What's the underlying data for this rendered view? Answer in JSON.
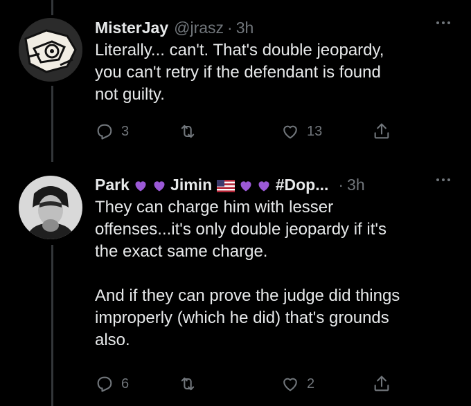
{
  "tweets": [
    {
      "name": "MisterJay",
      "handle": "@jrasz",
      "separator": "·",
      "time": "3h",
      "text": "Literally... can't. That's double jeopardy,\nyou can't retry if the defendant is found\nnot guilty.",
      "replies": "3",
      "retweets": "",
      "likes": "13"
    },
    {
      "name_parts": [
        "Park",
        "💜",
        "💜",
        "Jimin",
        "🇺🇸",
        "💜",
        "💜",
        "#Dop..."
      ],
      "separator": "·",
      "time": "3h",
      "text": "They can charge him with lesser\noffenses...it's only double jeopardy if it's\nthe exact same charge.\n\nAnd if they can prove the judge did things\nimproperly (which he did) that's grounds\nalso.",
      "replies": "6",
      "retweets": "",
      "likes": "2"
    }
  ],
  "colors": {
    "background": "#000000",
    "text": "#e7e9ea",
    "secondary": "#71767b",
    "thread_line": "#333639",
    "heart_purple": "#9b59d6"
  }
}
